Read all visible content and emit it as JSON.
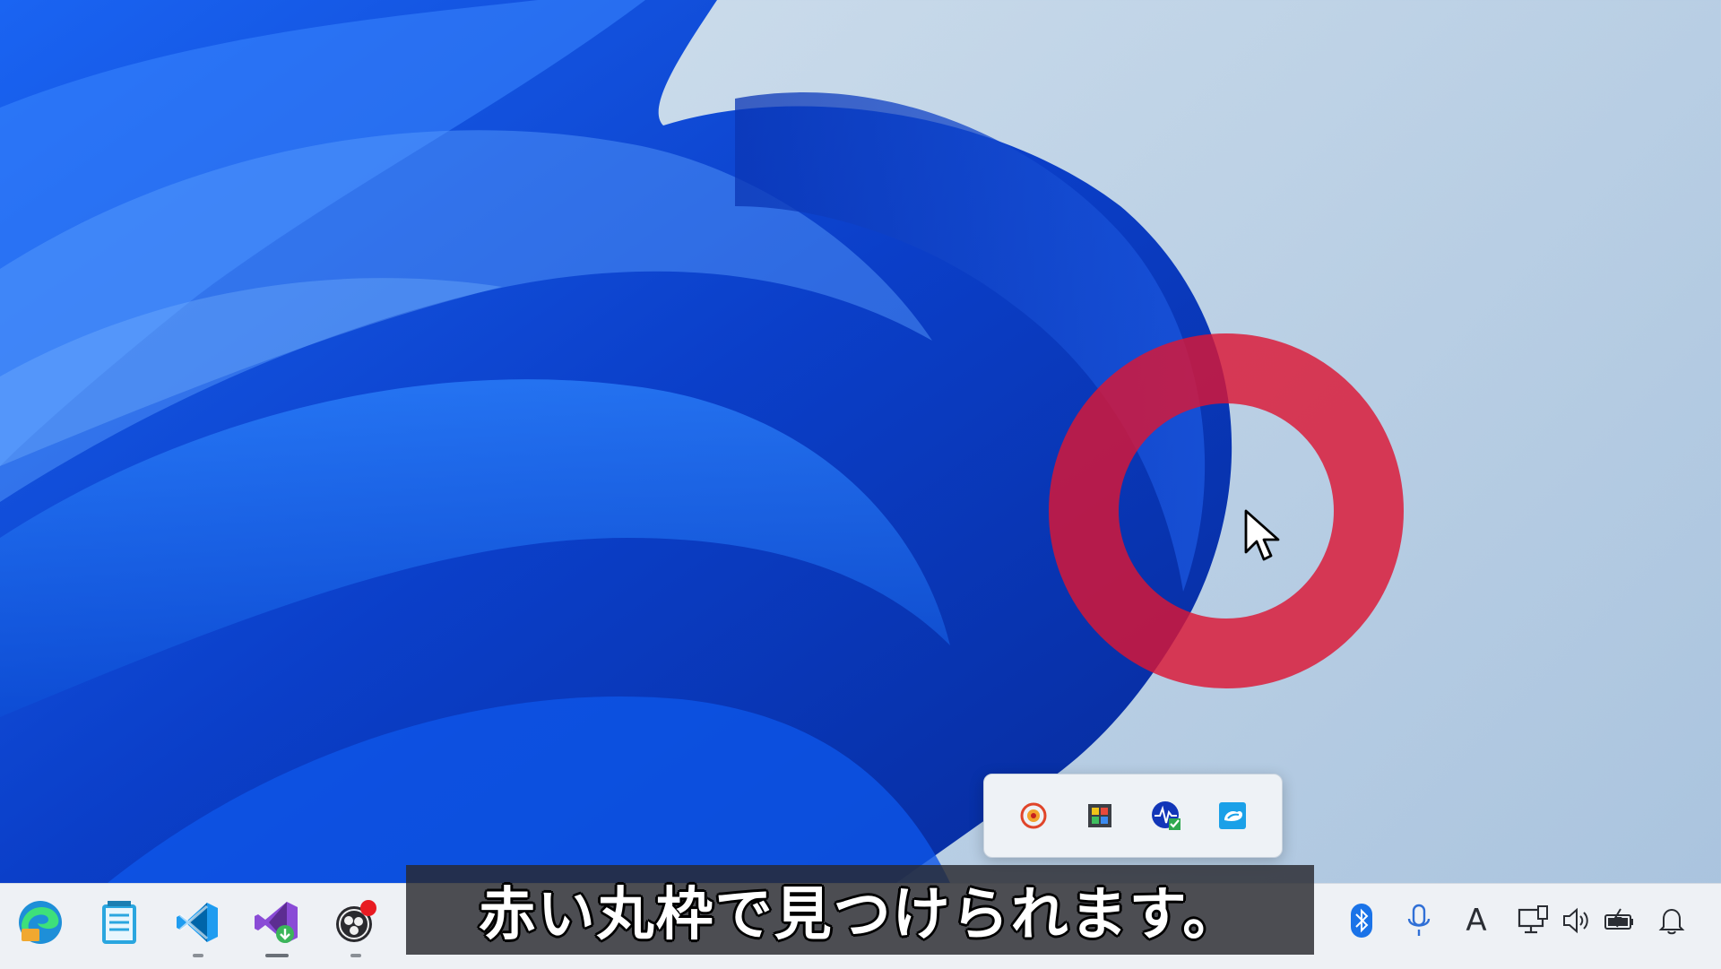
{
  "subtitle": "赤い丸枠で見つけられます。",
  "colors": {
    "highlight_ring": "#dc1634",
    "wallpaper_blue": "#0a3fd0",
    "taskbar_bg": "#eef1f5"
  },
  "tray_flyout": {
    "icons": [
      "recorder-tray-icon",
      "color-grid-tray-icon",
      "monitor-check-tray-icon",
      "app-cloud-tray-icon"
    ]
  },
  "taskbar": {
    "apps": [
      "edge-icon",
      "notepad-icon",
      "vscode-icon",
      "visual-studio-icon",
      "obs-icon"
    ],
    "system_tray": [
      "bluetooth-icon",
      "microphone-icon",
      "ime-mode-icon",
      "display-icon",
      "volume-icon",
      "battery-icon",
      "notification-bell-icon"
    ],
    "ime_label": "A"
  }
}
